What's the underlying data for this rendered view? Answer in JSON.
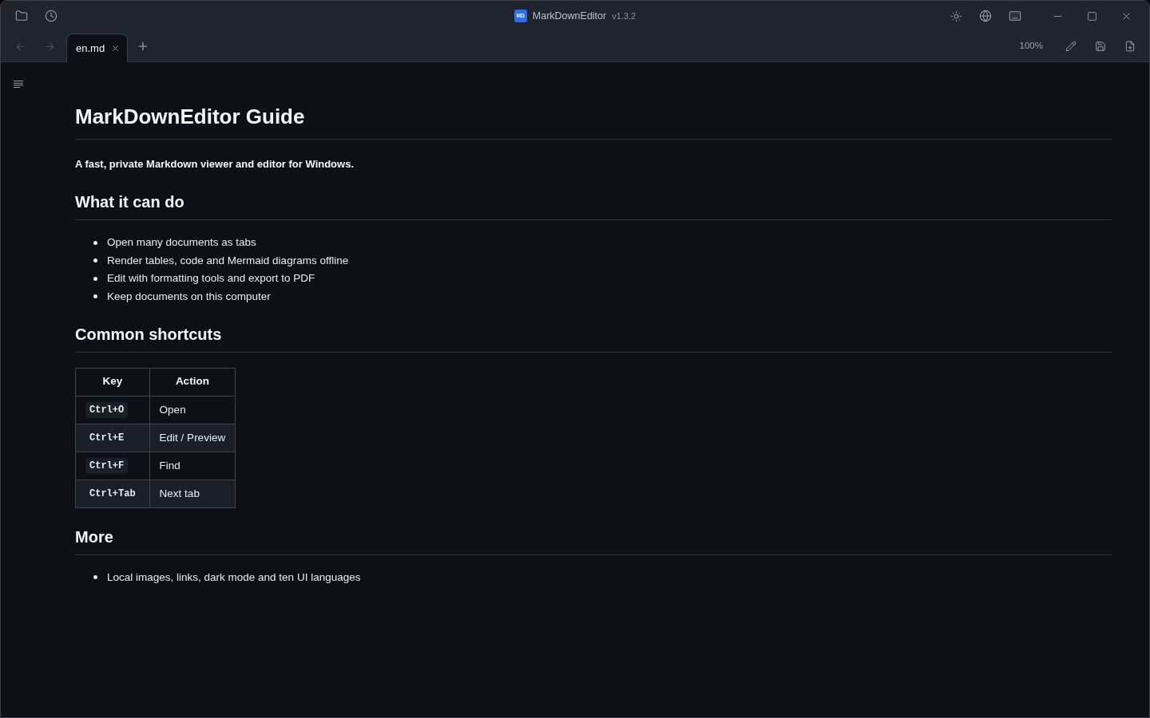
{
  "window": {
    "logo": "MD",
    "title": "MarkDownEditor",
    "version": "v1.3.2"
  },
  "navigation": [
    {
      "kind": "back",
      "disabled": true
    },
    {
      "kind": "forward",
      "disabled": true
    }
  ],
  "tabs": [
    {
      "label": "en.md",
      "selected": true
    }
  ],
  "toolbar": {
    "zoom": "100%"
  },
  "document": [
    {
      "kind": "h1",
      "text": "MarkDownEditor Guide"
    },
    {
      "kind": "paragraph",
      "bold": true,
      "text": "A fast, private Markdown viewer and editor for Windows."
    },
    {
      "kind": "h2",
      "text": "What it can do"
    },
    {
      "kind": "list",
      "items": [
        "Open many documents as tabs",
        "Render tables, code and Mermaid diagrams offline",
        "Edit with formatting tools and export to PDF",
        "Keep documents on this computer"
      ]
    },
    {
      "kind": "h2",
      "text": "Common shortcuts"
    },
    {
      "kind": "table",
      "columns": [
        "Key",
        "Action"
      ],
      "rows": [
        {
          "key": "Ctrl+O",
          "action": "Open"
        },
        {
          "key": "Ctrl+E",
          "action": "Edit / Preview"
        },
        {
          "key": "Ctrl+F",
          "action": "Find"
        },
        {
          "key": "Ctrl+Tab",
          "action": "Next tab"
        }
      ]
    },
    {
      "kind": "h2",
      "text": "More"
    },
    {
      "kind": "list",
      "items": [
        "Local images, links, dark mode and ten UI languages"
      ]
    }
  ]
}
